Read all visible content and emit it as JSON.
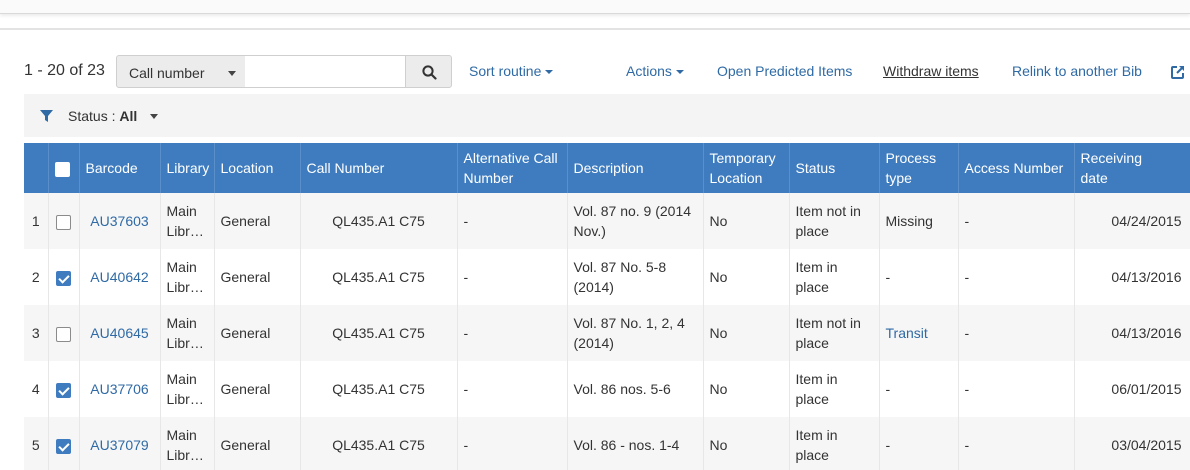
{
  "toolbar": {
    "count": "1 - 20 of 23",
    "search_field": "Call number",
    "search_value": "",
    "sort_label": "Sort routine",
    "actions_label": "Actions",
    "open_predicted": "Open Predicted Items",
    "withdraw": "Withdraw items",
    "relink": "Relink to another Bib"
  },
  "filter": {
    "label": "Status : ",
    "value": "All"
  },
  "columns": {
    "barcode": "Barcode",
    "library": "Library",
    "location": "Location",
    "call_number": "Call Number",
    "alt_call_1": "Alternative Call",
    "alt_call_2": "Number",
    "description": "Description",
    "temp_loc_1": "Temporary",
    "temp_loc_2": "Location",
    "status": "Status",
    "process_1": "Process",
    "process_2": "type",
    "access_number": "Access Number",
    "receiving_1": "Receiving",
    "receiving_2": "date"
  },
  "rows": [
    {
      "num": "1",
      "checked": false,
      "barcode": "AU37603",
      "lib1": "Main",
      "lib2": "Libra…",
      "location": "General",
      "call": "QL435.A1 C75",
      "alt": "-",
      "desc1": "Vol. 87 no. 9 (2014",
      "desc2": "Nov.)",
      "temp": "No",
      "status1": "Item not in",
      "status2": "place",
      "process": "Missing",
      "access": "-",
      "date": "04/24/2015"
    },
    {
      "num": "2",
      "checked": true,
      "barcode": "AU40642",
      "lib1": "Main",
      "lib2": "Libra…",
      "location": "General",
      "call": "QL435.A1 C75",
      "alt": "-",
      "desc1": "Vol. 87 No. 5-8",
      "desc2": "(2014)",
      "temp": "No",
      "status1": "Item in",
      "status2": "place",
      "process": "-",
      "access": "-",
      "date": "04/13/2016"
    },
    {
      "num": "3",
      "checked": false,
      "barcode": "AU40645",
      "lib1": "Main",
      "lib2": "Libra…",
      "location": "General",
      "call": "QL435.A1 C75",
      "alt": "-",
      "desc1": "Vol. 87 No. 1, 2, 4",
      "desc2": "(2014)",
      "temp": "No",
      "status1": "Item not in",
      "status2": "place",
      "process": "Transit",
      "access": "-",
      "date": "04/13/2016"
    },
    {
      "num": "4",
      "checked": true,
      "barcode": "AU37706",
      "lib1": "Main",
      "lib2": "Libra…",
      "location": "General",
      "call": "QL435.A1 C75",
      "alt": "-",
      "desc1": "Vol. 86 nos. 5-6",
      "desc2": "",
      "temp": "No",
      "status1": "Item in",
      "status2": "place",
      "process": "-",
      "access": "-",
      "date": "06/01/2015"
    },
    {
      "num": "5",
      "checked": true,
      "barcode": "AU37079",
      "lib1": "Main",
      "lib2": "Libra…",
      "location": "General",
      "call": "QL435.A1 C75",
      "alt": "-",
      "desc1": "Vol. 86 - nos. 1-4",
      "desc2": "",
      "temp": "No",
      "status1": "Item in",
      "status2": "place",
      "process": "-",
      "access": "-",
      "date": "03/04/2015"
    }
  ],
  "colors": {
    "header_bg": "#3f7cbf",
    "link": "#2f6aa5"
  },
  "icons": {
    "search": "search-icon",
    "filter": "filter-icon",
    "external": "external-link-icon"
  }
}
